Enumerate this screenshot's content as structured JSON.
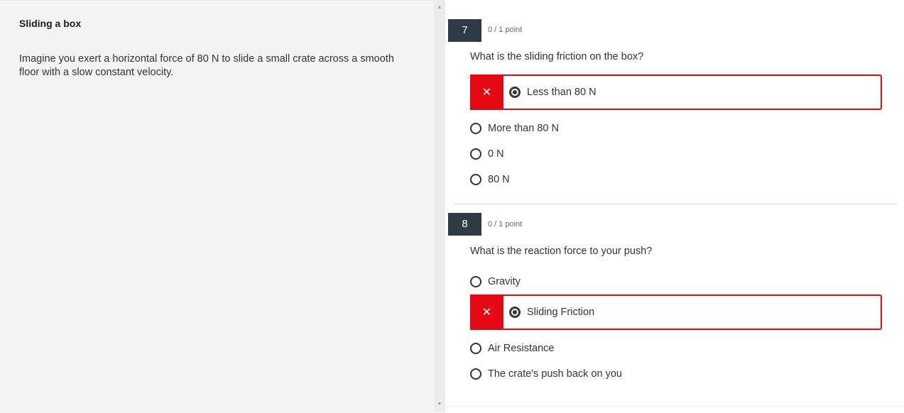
{
  "stimulus": {
    "title": "Sliding a box",
    "text": "Imagine you exert a horizontal force of 80 N to slide a small crate across a smooth floor with a slow constant velocity."
  },
  "scrollbar": {
    "up_icon": "▲",
    "down_icon": "▼"
  },
  "questions": [
    {
      "number": "7",
      "points": "0 / 1 point",
      "text": "What is the sliding friction on the box?",
      "wrong_icon": "✕",
      "options": [
        {
          "label": "Less than 80 N",
          "selected": true,
          "status": "incorrect"
        },
        {
          "label": "More than 80 N",
          "selected": false
        },
        {
          "label": "0 N",
          "selected": false
        },
        {
          "label": "80 N",
          "selected": false
        }
      ]
    },
    {
      "number": "8",
      "points": "0 / 1 point",
      "text": "What is the reaction force to your push?",
      "wrong_icon": "✕",
      "options": [
        {
          "label": "Gravity",
          "selected": false
        },
        {
          "label": "Sliding Friction",
          "selected": true,
          "status": "incorrect"
        },
        {
          "label": "Air Resistance",
          "selected": false
        },
        {
          "label": "The crate's push back on you",
          "selected": false
        }
      ]
    }
  ],
  "colors": {
    "incorrect": "#e50914",
    "number_badge": "#2f3b44",
    "panel_bg": "#f4f4f4"
  }
}
